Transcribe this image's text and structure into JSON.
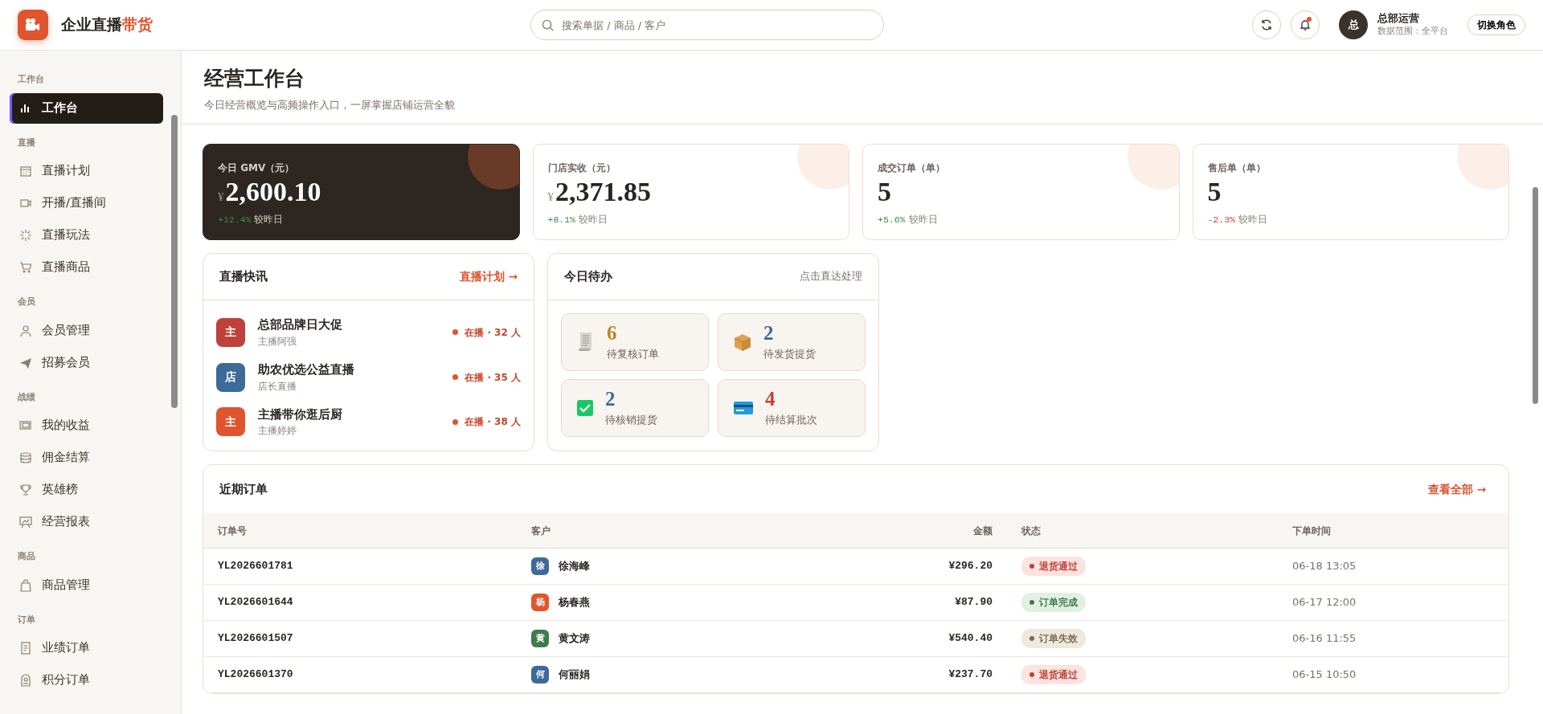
{
  "header": {
    "brand": {
      "name": "企业直播",
      "accent": "带货"
    },
    "search": {
      "placeholder": "搜索单据 / 商品 / 客户"
    },
    "notification_unread": true,
    "user": {
      "avatar": "总",
      "name": "总部运营",
      "scope": "数据范围：全平台"
    },
    "switch_role": "切换角色"
  },
  "sidebar": [
    {
      "title": "工作台",
      "items": [
        {
          "label": "工作台",
          "selected": true
        }
      ]
    },
    {
      "title": "直播",
      "items": [
        {
          "label": "直播计划",
          "selected": false
        },
        {
          "label": "开播/直播间",
          "selected": false
        },
        {
          "label": "直播玩法",
          "selected": false
        },
        {
          "label": "直播商品",
          "selected": false
        }
      ]
    },
    {
      "title": "会员",
      "items": [
        {
          "label": "会员管理",
          "selected": false
        },
        {
          "label": "招募会员",
          "selected": false
        }
      ]
    },
    {
      "title": "战绩",
      "items": [
        {
          "label": "我的收益",
          "selected": false
        },
        {
          "label": "佣金结算",
          "selected": false
        },
        {
          "label": "英雄榜",
          "selected": false
        },
        {
          "label": "经营报表",
          "selected": false
        }
      ]
    },
    {
      "title": "商品",
      "items": [
        {
          "label": "商品管理",
          "selected": false
        }
      ]
    },
    {
      "title": "订单",
      "items": [
        {
          "label": "业绩订单",
          "selected": false
        },
        {
          "label": "积分订单",
          "selected": false
        }
      ]
    }
  ],
  "page": {
    "title": "经营工作台",
    "subtitle": "今日经营概览与高频操作入口，一屏掌握店铺运营全貌"
  },
  "stats": [
    {
      "label": "今日 GMV（元）",
      "currency": "¥",
      "value": "2,600.10",
      "delta": "+12.4%",
      "kind": "up",
      "note": "较昨日",
      "highlighted": true
    },
    {
      "label": "门店实收（元）",
      "currency": "¥",
      "value": "2,371.85",
      "delta": "+8.1%",
      "kind": "up",
      "note": "较昨日",
      "highlighted": false
    },
    {
      "label": "成交订单（单）",
      "value": "5",
      "delta": "+5.6%",
      "kind": "up",
      "note": "较昨日",
      "highlighted": false
    },
    {
      "label": "售后单（单）",
      "value": "5",
      "delta": "-2.3%",
      "kind": "down",
      "note": "较昨日",
      "highlighted": false
    }
  ],
  "live_news": {
    "title": "直播快讯",
    "link": "直播计划 →",
    "items": [
      {
        "avatar": "主",
        "color": "#c0413b",
        "title": "总部品牌日大促",
        "host": "主播阿强",
        "status": "在播 · 32 人"
      },
      {
        "avatar": "店",
        "color": "#3d6a98",
        "title": "助农优选公益直播",
        "host": "店长直播",
        "status": "在播 · 35 人"
      },
      {
        "avatar": "主",
        "color": "#e0552e",
        "title": "主播带你逛后厨",
        "host": "主播婷婷",
        "status": "在播 · 38 人"
      }
    ]
  },
  "todo": {
    "title": "今日待办",
    "hint": "点击直达处理",
    "items": [
      {
        "count": "6",
        "label": "待复核订单",
        "color": "#b8862b"
      },
      {
        "count": "2",
        "label": "待发货提货",
        "color": "#3d6a98"
      },
      {
        "count": "2",
        "label": "待核销提货",
        "color": "#3d6a98"
      },
      {
        "count": "4",
        "label": "待结算批次",
        "color": "#c0413b"
      }
    ]
  },
  "orders": {
    "title": "近期订单",
    "link": "查看全部 →",
    "columns": [
      "订单号",
      "客户",
      "金额",
      "状态",
      "下单时间"
    ],
    "rows": [
      {
        "order_no": "YL2026601781",
        "initial": "徐",
        "color": "#3d6a98",
        "customer": "徐海峰",
        "amount": "¥296.20",
        "status": "退货通过",
        "kind": "refund",
        "time": "06-18 13:05"
      },
      {
        "order_no": "YL2026601644",
        "initial": "杨",
        "color": "#e0552e",
        "customer": "杨春燕",
        "amount": "¥87.90",
        "status": "订单完成",
        "kind": "done",
        "time": "06-17 12:00"
      },
      {
        "order_no": "YL2026601507",
        "initial": "黄",
        "color": "#3f7a4f",
        "customer": "黄文涛",
        "amount": "¥540.40",
        "status": "订单失效",
        "kind": "failed",
        "time": "06-16 11:55"
      },
      {
        "order_no": "YL2026601370",
        "initial": "何",
        "color": "#3d6a98",
        "customer": "何丽娟",
        "amount": "¥237.70",
        "status": "退货通过",
        "kind": "refund",
        "time": "06-15 10:50"
      }
    ]
  }
}
